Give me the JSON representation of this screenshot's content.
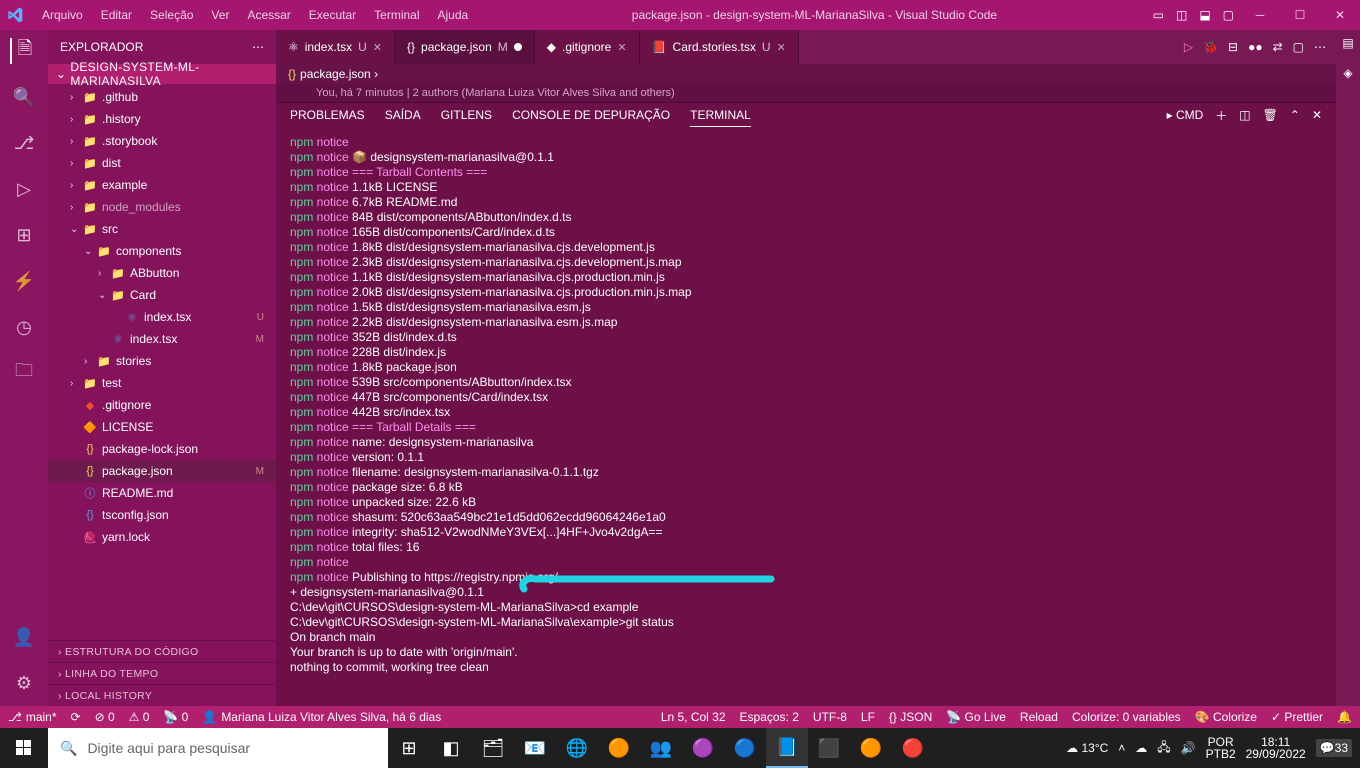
{
  "window": {
    "title": "package.json - design-system-ML-MarianaSilva - Visual Studio Code"
  },
  "menu": [
    "Arquivo",
    "Editar",
    "Seleção",
    "Ver",
    "Acessar",
    "Executar",
    "Terminal",
    "Ajuda"
  ],
  "explorer": {
    "header": "EXPLORADOR",
    "root": "DESIGN-SYSTEM-ML-MARIANASILVA",
    "tree": [
      {
        "l": 1,
        "chev": "›",
        "ico": "📁",
        "cls": "folder-ico",
        "name": ".github"
      },
      {
        "l": 1,
        "chev": "›",
        "ico": "📁",
        "cls": "folder-ico",
        "name": ".history"
      },
      {
        "l": 1,
        "chev": "›",
        "ico": "📁",
        "cls": "folder-ico",
        "name": ".storybook"
      },
      {
        "l": 1,
        "chev": "›",
        "ico": "📁",
        "cls": "folder-ico",
        "name": "dist"
      },
      {
        "l": 1,
        "chev": "›",
        "ico": "📁",
        "cls": "folder-ico",
        "name": "example"
      },
      {
        "l": 1,
        "chev": "›",
        "ico": "📁",
        "cls": "folder-ico",
        "name": "node_modules",
        "dim": true
      },
      {
        "l": 1,
        "chev": "⌄",
        "ico": "📁",
        "cls": "folder-ico",
        "name": "src"
      },
      {
        "l": 2,
        "chev": "⌄",
        "ico": "📁",
        "cls": "folder-ico",
        "name": "components"
      },
      {
        "l": 3,
        "chev": "›",
        "ico": "📁",
        "cls": "folder-ico",
        "name": "ABbutton"
      },
      {
        "l": 3,
        "chev": "⌄",
        "ico": "📁",
        "cls": "folder-ico",
        "name": "Card"
      },
      {
        "l": 4,
        "chev": "",
        "ico": "⚛",
        "cls": "ts-ico",
        "name": "index.tsx",
        "badge": "U"
      },
      {
        "l": 3,
        "chev": "",
        "ico": "⚛",
        "cls": "ts-ico",
        "name": "index.tsx",
        "badge": "M"
      },
      {
        "l": 2,
        "chev": "›",
        "ico": "📁",
        "cls": "folder-ico",
        "name": "stories"
      },
      {
        "l": 1,
        "chev": "›",
        "ico": "📁",
        "cls": "folder-ico",
        "name": "test"
      },
      {
        "l": 1,
        "chev": "",
        "ico": "◆",
        "cls": "git-ico",
        "name": ".gitignore"
      },
      {
        "l": 1,
        "chev": "",
        "ico": "🔶",
        "cls": "",
        "name": "LICENSE"
      },
      {
        "l": 1,
        "chev": "",
        "ico": "{}",
        "cls": "json-ico",
        "name": "package-lock.json"
      },
      {
        "l": 1,
        "chev": "",
        "ico": "{}",
        "cls": "json-ico",
        "name": "package.json",
        "badge": "M",
        "sel": true
      },
      {
        "l": 1,
        "chev": "",
        "ico": "ⓘ",
        "cls": "md-ico",
        "name": "README.md"
      },
      {
        "l": 1,
        "chev": "",
        "ico": "{}",
        "cls": "ts-ico",
        "name": "tsconfig.json"
      },
      {
        "l": 1,
        "chev": "",
        "ico": "🧶",
        "cls": "yarn-ico",
        "name": "yarn.lock"
      }
    ],
    "collapsed": [
      "ESTRUTURA DO CÓDIGO",
      "LINHA DO TEMPO",
      "LOCAL HISTORY"
    ]
  },
  "tabs": [
    {
      "ico": "⚛",
      "name": "index.tsx",
      "suffix": "U",
      "active": false
    },
    {
      "ico": "{}",
      "name": "package.json",
      "suffix": "M",
      "active": true,
      "modified": true
    },
    {
      "ico": "◆",
      "name": ".gitignore",
      "active": false
    },
    {
      "ico": "📕",
      "name": "Card.stories.tsx",
      "suffix": "U",
      "active": false
    }
  ],
  "breadcrumb": "package.json ›",
  "blame": "You, há 7 minutos | 2 authors (Mariana Luiza Vitor Alves Silva and others)",
  "panel": {
    "tabs": [
      "PROBLEMAS",
      "SAÍDA",
      "GITLENS",
      "CONSOLE DE DEPURAÇÃO",
      "TERMINAL"
    ],
    "activeTab": 4,
    "shell": "cmd"
  },
  "terminal_lines": [
    [
      [
        "g",
        "npm"
      ],
      [
        "m",
        " notice"
      ]
    ],
    [
      [
        "g",
        "npm"
      ],
      [
        "m",
        " notice "
      ],
      [
        "w",
        "📦  designsystem-marianasilva@0.1.1"
      ]
    ],
    [
      [
        "g",
        "npm"
      ],
      [
        "m",
        " notice "
      ],
      [
        "m",
        "=== Tarball Contents ==="
      ]
    ],
    [
      [
        "g",
        "npm"
      ],
      [
        "m",
        " notice "
      ],
      [
        "w",
        "1.1kB LICENSE"
      ]
    ],
    [
      [
        "g",
        "npm"
      ],
      [
        "m",
        " notice "
      ],
      [
        "w",
        "6.7kB README.md"
      ]
    ],
    [
      [
        "g",
        "npm"
      ],
      [
        "m",
        " notice "
      ],
      [
        "w",
        "84B   dist/components/ABbutton/index.d.ts"
      ]
    ],
    [
      [
        "g",
        "npm"
      ],
      [
        "m",
        " notice "
      ],
      [
        "w",
        "165B  dist/components/Card/index.d.ts"
      ]
    ],
    [
      [
        "g",
        "npm"
      ],
      [
        "m",
        " notice "
      ],
      [
        "w",
        "1.8kB dist/designsystem-marianasilva.cjs.development.js"
      ]
    ],
    [
      [
        "g",
        "npm"
      ],
      [
        "m",
        " notice "
      ],
      [
        "w",
        "2.3kB dist/designsystem-marianasilva.cjs.development.js.map"
      ]
    ],
    [
      [
        "g",
        "npm"
      ],
      [
        "m",
        " notice "
      ],
      [
        "w",
        "1.1kB dist/designsystem-marianasilva.cjs.production.min.js"
      ]
    ],
    [
      [
        "g",
        "npm"
      ],
      [
        "m",
        " notice "
      ],
      [
        "w",
        "2.0kB dist/designsystem-marianasilva.cjs.production.min.js.map"
      ]
    ],
    [
      [
        "g",
        "npm"
      ],
      [
        "m",
        " notice "
      ],
      [
        "w",
        "1.5kB dist/designsystem-marianasilva.esm.js"
      ]
    ],
    [
      [
        "g",
        "npm"
      ],
      [
        "m",
        " notice "
      ],
      [
        "w",
        "2.2kB dist/designsystem-marianasilva.esm.js.map"
      ]
    ],
    [
      [
        "g",
        "npm"
      ],
      [
        "m",
        " notice "
      ],
      [
        "w",
        "352B  dist/index.d.ts"
      ]
    ],
    [
      [
        "g",
        "npm"
      ],
      [
        "m",
        " notice "
      ],
      [
        "w",
        "228B  dist/index.js"
      ]
    ],
    [
      [
        "g",
        "npm"
      ],
      [
        "m",
        " notice "
      ],
      [
        "w",
        "1.8kB package.json"
      ]
    ],
    [
      [
        "g",
        "npm"
      ],
      [
        "m",
        " notice "
      ],
      [
        "w",
        "539B  src/components/ABbutton/index.tsx"
      ]
    ],
    [
      [
        "g",
        "npm"
      ],
      [
        "m",
        " notice "
      ],
      [
        "w",
        "447B  src/components/Card/index.tsx"
      ]
    ],
    [
      [
        "g",
        "npm"
      ],
      [
        "m",
        " notice "
      ],
      [
        "w",
        "442B  src/index.tsx"
      ]
    ],
    [
      [
        "g",
        "npm"
      ],
      [
        "m",
        " notice "
      ],
      [
        "m",
        "=== Tarball Details ==="
      ]
    ],
    [
      [
        "g",
        "npm"
      ],
      [
        "m",
        " notice "
      ],
      [
        "w",
        "name:          designsystem-marianasilva"
      ]
    ],
    [
      [
        "g",
        "npm"
      ],
      [
        "m",
        " notice "
      ],
      [
        "w",
        "version:       0.1.1"
      ]
    ],
    [
      [
        "g",
        "npm"
      ],
      [
        "m",
        " notice "
      ],
      [
        "w",
        "filename:      designsystem-marianasilva-0.1.1.tgz"
      ]
    ],
    [
      [
        "g",
        "npm"
      ],
      [
        "m",
        " notice "
      ],
      [
        "w",
        "package size:  6.8 kB"
      ]
    ],
    [
      [
        "g",
        "npm"
      ],
      [
        "m",
        " notice "
      ],
      [
        "w",
        "unpacked size: 22.6 kB"
      ]
    ],
    [
      [
        "g",
        "npm"
      ],
      [
        "m",
        " notice "
      ],
      [
        "w",
        "shasum:        520c63aa549bc21e1d5dd062ecdd96064246e1a0"
      ]
    ],
    [
      [
        "g",
        "npm"
      ],
      [
        "m",
        " notice "
      ],
      [
        "w",
        "integrity:     sha512-V2wodNMeY3VEx[...]4HF+Jvo4v2dgA=="
      ]
    ],
    [
      [
        "g",
        "npm"
      ],
      [
        "m",
        " notice "
      ],
      [
        "w",
        "total files:   16"
      ]
    ],
    [
      [
        "g",
        "npm"
      ],
      [
        "m",
        " notice"
      ]
    ],
    [
      [
        "g",
        "npm"
      ],
      [
        "m",
        " notice "
      ],
      [
        "w",
        "Publishing to https://registry.npmjs.org/"
      ]
    ],
    [
      [
        "w",
        "+ designsystem-marianasilva@0.1.1"
      ]
    ],
    [
      [
        "w",
        ""
      ]
    ],
    [
      [
        "w",
        "C:\\dev\\git\\CURSOS\\design-system-ML-MarianaSilva>cd example"
      ]
    ],
    [
      [
        "w",
        ""
      ]
    ],
    [
      [
        "w",
        "C:\\dev\\git\\CURSOS\\design-system-ML-MarianaSilva\\example>git status"
      ]
    ],
    [
      [
        "w",
        "On branch main"
      ]
    ],
    [
      [
        "w",
        "Your branch is up to date with 'origin/main'."
      ]
    ],
    [
      [
        "w",
        ""
      ]
    ],
    [
      [
        "w",
        "nothing to commit, working tree clean"
      ]
    ]
  ],
  "status": {
    "branch": "main*",
    "sync": "⟳",
    "errors": "⊘ 0",
    "warnings": "⚠ 0",
    "port": "📡 0",
    "blame": "Mariana Luiza Vitor Alves Silva, há 6 dias",
    "cursor": "Ln 5, Col 32",
    "spaces": "Espaços: 2",
    "encoding": "UTF-8",
    "eol": "LF",
    "lang": "{} JSON",
    "live": "📡 Go Live",
    "reload": "Reload",
    "colorize": "Colorize: 0 variables",
    "colorize2": "🎨 Colorize",
    "prettier": "✓ Prettier"
  },
  "taskbar": {
    "search_placeholder": "Digite aqui para pesquisar",
    "weather": "13°C",
    "lang": "PTB2",
    "ime": "POR",
    "time": "18:11",
    "date": "29/09/2022",
    "notif": "33"
  }
}
